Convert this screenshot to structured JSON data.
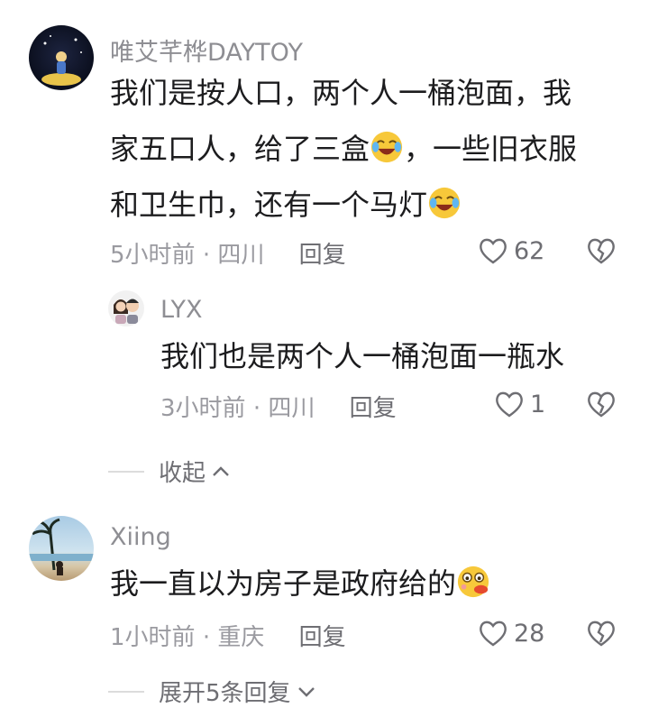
{
  "comments": [
    {
      "username": "唯艾芊桦DAYTOY",
      "text_lines": [
        "我们是按人口，两个人一桶泡面，我",
        "家五口人，给了三盒",
        "，一些旧衣服",
        "和卫生巾，还有一个马灯"
      ],
      "time": "5小时前",
      "location": "四川",
      "reply_label": "回复",
      "likes": "62"
    },
    {
      "username": "LYX",
      "text": "我们也是两个人一桶泡面一瓶水",
      "time": "3小时前",
      "location": "四川",
      "reply_label": "回复",
      "likes": "1"
    },
    {
      "username": "Xiing",
      "text": "我一直以为房子是政府给的",
      "time": "1小时前",
      "location": "重庆",
      "reply_label": "回复",
      "likes": "28"
    }
  ],
  "collapse_label": "收起",
  "expand_label": "展开5条回复",
  "separator": "·",
  "icons": {
    "like": "heart-outline-icon",
    "dislike": "broken-heart-icon",
    "emoji_laugh": "laugh-cry-emoji",
    "emoji_shy": "shy-emoji"
  }
}
